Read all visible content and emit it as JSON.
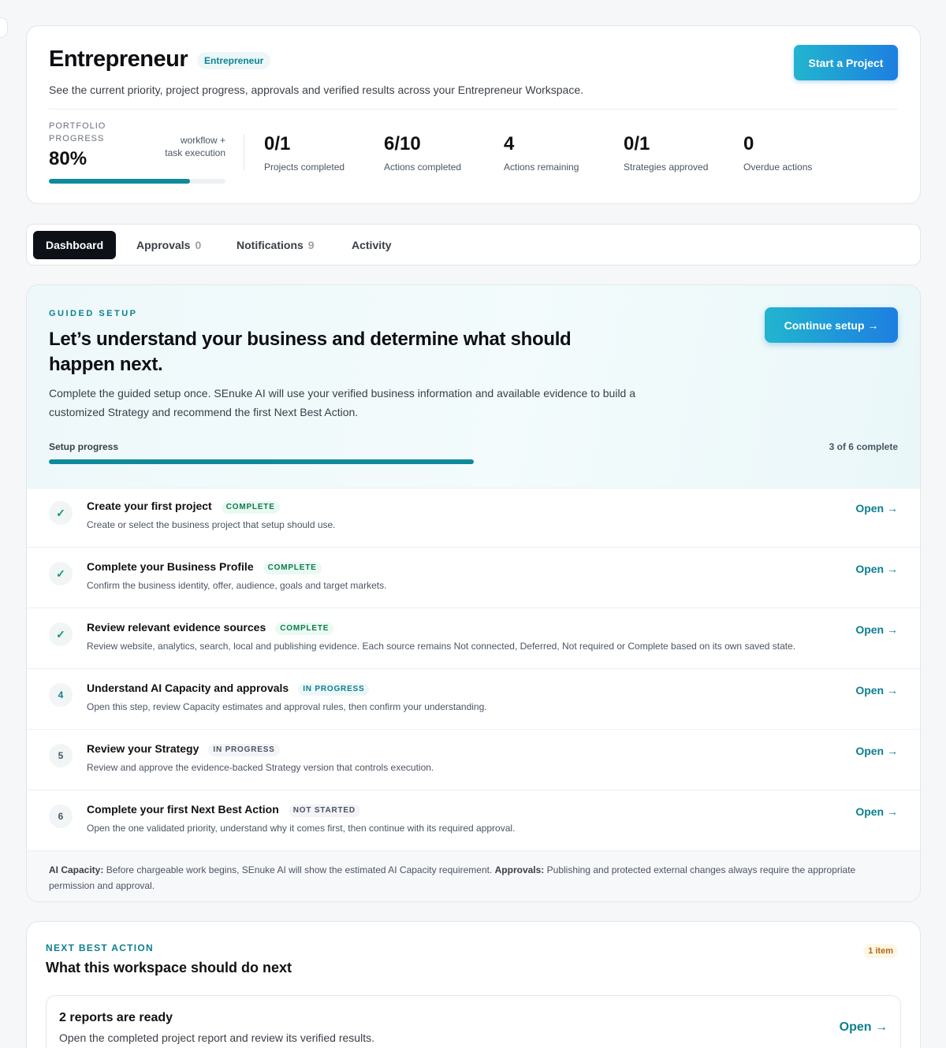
{
  "header": {
    "title": "Entrepreneur",
    "badge": "Entrepreneur",
    "start_button": "Start a Project",
    "subtitle": "See the current priority, project progress, approvals and verified results across your Entrepreneur Workspace.",
    "portfolio_label": "PORTFOLIO PROGRESS",
    "portfolio_value": "80%",
    "portfolio_fraction": 0.8,
    "portfolio_note": "workflow + task execution",
    "stats": [
      {
        "value": "0/1",
        "label": "Projects completed"
      },
      {
        "value": "6/10",
        "label": "Actions completed"
      },
      {
        "value": "4",
        "label": "Actions remaining"
      },
      {
        "value": "0/1",
        "label": "Strategies approved"
      },
      {
        "value": "0",
        "label": "Overdue actions"
      }
    ]
  },
  "tabs": [
    {
      "label": "Dashboard",
      "count": ""
    },
    {
      "label": "Approvals",
      "count": "0"
    },
    {
      "label": "Notifications",
      "count": "9"
    },
    {
      "label": "Activity",
      "count": ""
    }
  ],
  "guided_setup": {
    "eyebrow": "GUIDED SETUP",
    "title": "Let’s understand your business and determine what should happen next.",
    "description": "Complete the guided setup once. SEnuke AI will use your verified business information and available evidence to build a customized Strategy and recommend the first Next Best Action.",
    "continue_button": "Continue setup →",
    "progress_label": "Setup progress",
    "progress_count": "3 of 6 complete",
    "progress_fraction": 0.5,
    "steps": [
      {
        "marker": "✓",
        "title": "Create your first project",
        "status": "COMPLETE",
        "description": "Create or select the business project that setup should use.",
        "action": "Open →"
      },
      {
        "marker": "✓",
        "title": "Complete your Business Profile",
        "status": "COMPLETE",
        "description": "Confirm the business identity, offer, audience, goals and target markets.",
        "action": "Open →"
      },
      {
        "marker": "✓",
        "title": "Review relevant evidence sources",
        "status": "COMPLETE",
        "description": "Review website, analytics, search, local and publishing evidence. Each source remains Not connected, Deferred, Not required or Complete based on its own saved state.",
        "action": "Open →"
      },
      {
        "marker": "4",
        "title": "Understand AI Capacity and approvals",
        "status": "IN PROGRESS",
        "description": "Open this step, review Capacity estimates and approval rules, then confirm your understanding.",
        "action": "Open →"
      },
      {
        "marker": "5",
        "title": "Review your Strategy",
        "status": "IN PROGRESS",
        "description": "Review and approve the evidence-backed Strategy version that controls execution.",
        "action": "Open →"
      },
      {
        "marker": "6",
        "title": "Complete your first Next Best Action",
        "status": "NOT STARTED",
        "description": "Open the one validated priority, understand why it comes first, then continue with its required approval.",
        "action": "Open →"
      }
    ],
    "footer": {
      "capacity_label": "AI Capacity:",
      "capacity_text": " Before chargeable work begins, SEnuke AI will show the estimated AI Capacity requirement. ",
      "approvals_label": "Approvals:",
      "approvals_text": " Publishing and protected external changes always require the appropriate permission and approval."
    }
  },
  "next_best_action": {
    "eyebrow": "NEXT BEST ACTION",
    "title": "What this workspace should do next",
    "badge": "1 item",
    "item": {
      "title": "2 reports are ready",
      "description": "Open the completed project report and review its verified results.",
      "action": "Open →"
    }
  }
}
